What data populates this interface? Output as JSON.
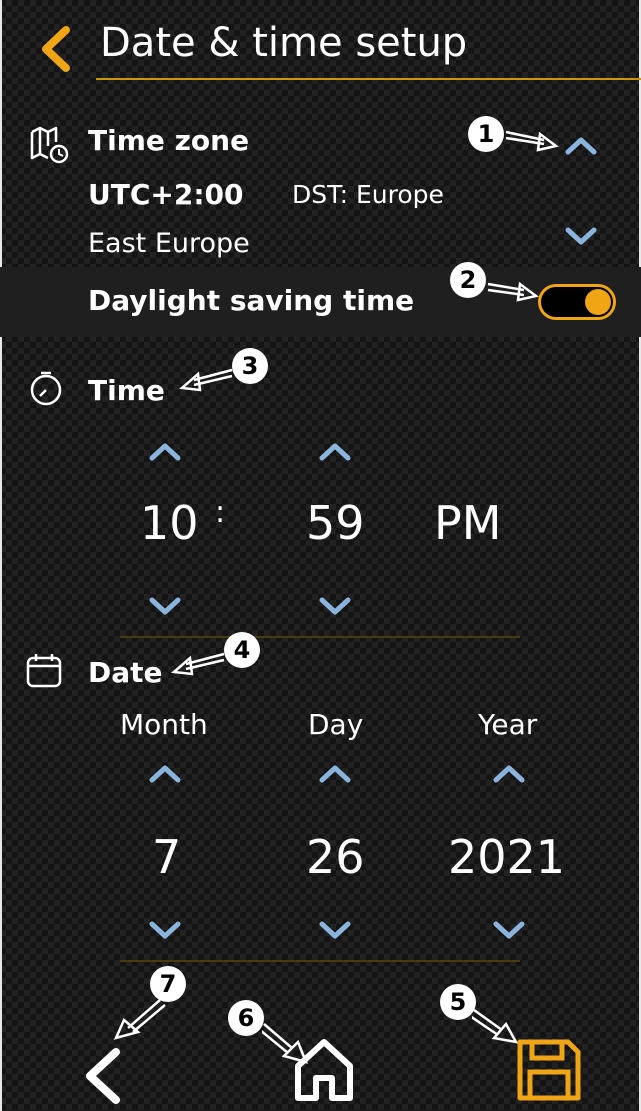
{
  "header": {
    "title": "Date & time setup",
    "back_icon": "chevron-left-icon"
  },
  "time_zone": {
    "label": "Time zone",
    "offset": "UTC+2:00",
    "dst_rule": "DST: Europe",
    "region": "East Europe",
    "dst_toggle_label": "Daylight saving time",
    "dst_enabled": true
  },
  "time": {
    "label": "Time",
    "hour": "10",
    "separator": ":",
    "minute": "59",
    "meridiem": "PM"
  },
  "date": {
    "label": "Date",
    "month_label": "Month",
    "day_label": "Day",
    "year_label": "Year",
    "month": "7",
    "day": "26",
    "year": "2021"
  },
  "footer": {
    "back_icon": "chevron-left-icon",
    "home_icon": "home-icon",
    "save_icon": "save-icon"
  },
  "callouts": [
    "1",
    "2",
    "3",
    "4",
    "5",
    "6",
    "7"
  ],
  "colors": {
    "accent": "#f0a514",
    "arrow_blue": "#8ab4dc",
    "background": "#141414"
  }
}
